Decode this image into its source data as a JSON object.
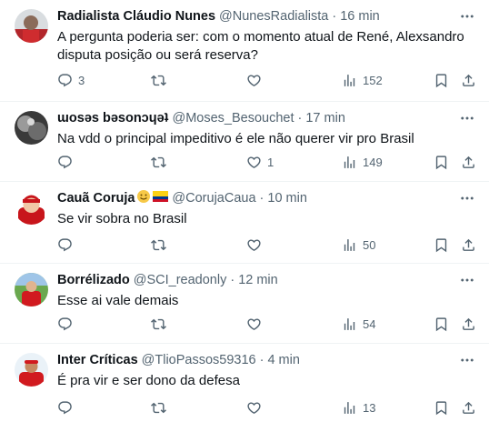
{
  "tweets": [
    {
      "name": "Radialista Cláudio Nunes",
      "handle": "@NunesRadialista",
      "dot": "·",
      "time": "16 min",
      "text": "A pergunta poderia ser: com o momento atual de René, Alexsandro disputa posição ou será reserva?",
      "replies": "3",
      "retweets": "",
      "likes": "",
      "views": "152"
    },
    {
      "name": "ɯosǝs bǝsonɔɥǝʇ",
      "handle": "@Moses_Besouchet",
      "dot": "·",
      "time": "17 min",
      "text": "Na vdd o principal impeditivo é ele não querer vir pro Brasil",
      "replies": "",
      "retweets": "",
      "likes": "1",
      "views": "149"
    },
    {
      "name": "Cauã Coruja",
      "handle": "@CorujaCaua",
      "dot": "·",
      "time": "10 min",
      "text": "Se vir sobra no Brasil",
      "replies": "",
      "retweets": "",
      "likes": "",
      "views": "50"
    },
    {
      "name": "Borrélizado",
      "handle": "@SCI_readonly",
      "dot": "·",
      "time": "12 min",
      "text": "Esse ai vale demais",
      "replies": "",
      "retweets": "",
      "likes": "",
      "views": "54"
    },
    {
      "name": "Inter Críticas",
      "handle": "@TlioPassos59316",
      "dot": "·",
      "time": "4 min",
      "text": "É pra vir e ser dono da defesa",
      "replies": "",
      "retweets": "",
      "likes": "",
      "views": "13"
    }
  ],
  "icons": {
    "more": "more-horizontal-icon",
    "reply": "reply-bubble-icon",
    "retweet": "retweet-arrows-icon",
    "like": "heart-outline-icon",
    "views": "views-bar-chart-icon",
    "bookmark": "bookmark-icon",
    "share": "share-upload-icon"
  },
  "colors": {
    "text": "#0f1419",
    "secondary": "#536471",
    "divider": "#eff3f4",
    "inter_red": "#d11a1f"
  }
}
